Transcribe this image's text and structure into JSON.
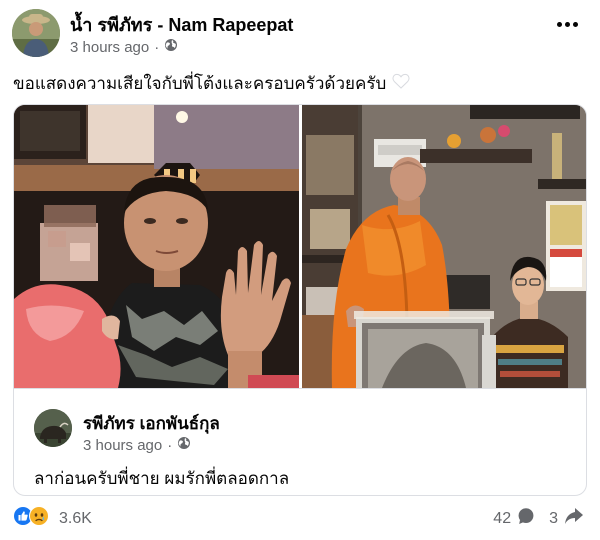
{
  "post": {
    "author": "น้ำ รพีภัทร - Nam Rapeepat",
    "time": "3 hours ago",
    "dot": "·",
    "caption": "ขอแสดงความเสียใจกับพี่โต้งและครอบครัวด้วยครับ",
    "more_icon": "more-dots-icon",
    "privacy_icon": "globe-icon"
  },
  "shared": {
    "author": "รพีภัทร เอกพันธ์กุล",
    "time": "3 hours ago",
    "dot": "·",
    "text": "ลาก่อนครับพี่ชาย ผมรักพี่ตลอดกาล",
    "photos": [
      "photo-man-with-child",
      "photo-monk-with-man-and-frame"
    ]
  },
  "reactions": {
    "icons": [
      "like-icon",
      "sad-icon"
    ],
    "total": "3.6K"
  },
  "stats": {
    "comments": "42",
    "shares": "3"
  },
  "colors": {
    "text": "#050505",
    "secondary": "#65676b",
    "like_blue": "#1877f2",
    "sad_yellow": "#f7b125",
    "robe_orange": "#e9741d"
  }
}
